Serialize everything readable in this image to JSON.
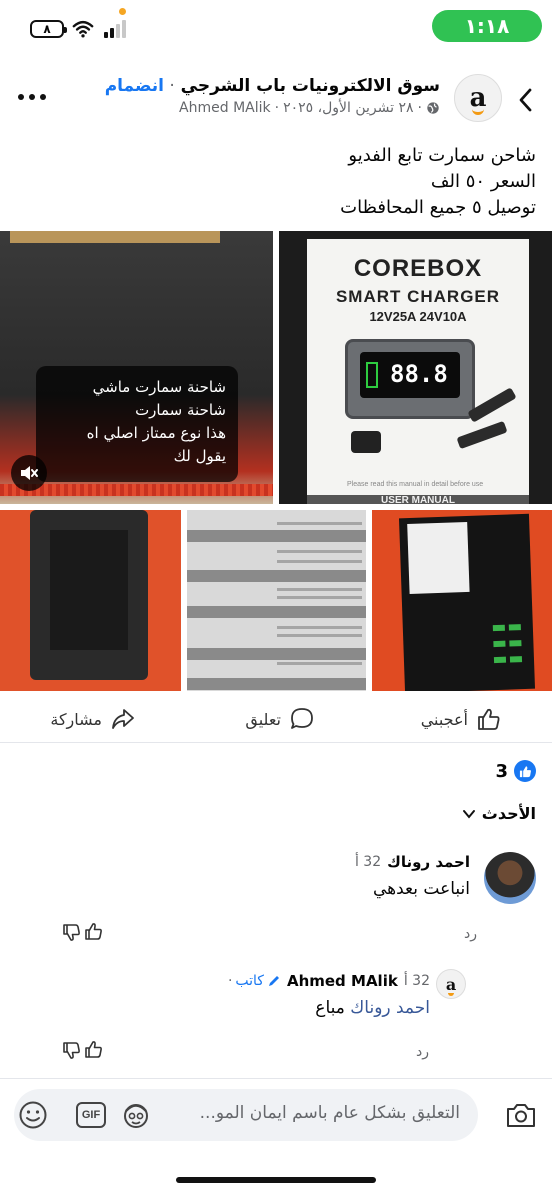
{
  "status_bar": {
    "time": "١:١٨",
    "battery": "٨"
  },
  "post": {
    "page_name": "سوق الالكترونيات باب الشرجي",
    "join_label": "انضمام",
    "author": "Ahmed MAlik",
    "date": "٢٨ تشرين الأول، ٢٠٢٥",
    "text_lines": [
      "شاحن سمارت تابع الفديو",
      "السعر ٥٠ الف",
      "توصيل ٥ جميع المحافظات"
    ]
  },
  "media": {
    "overlay_lines": [
      "شاحنة سمارت ماشي",
      "شاحنة سمارت",
      "هذا نوع ممتاز اصلي اه",
      "يقول لك"
    ],
    "product_brand": "COREBOX",
    "product_title": "SMART CHARGER",
    "product_spec": "12V25A  24V10A",
    "display_digits": "88.8",
    "manual_label": "USER MANUAL",
    "manual_note": "Please read this manual in detail before use"
  },
  "actions": {
    "like": "أعجبني",
    "comment": "تعليق",
    "share": "مشاركة"
  },
  "reactions": {
    "count": "3"
  },
  "sort": {
    "label": "الأحدث"
  },
  "comments": [
    {
      "name": "احمد روناك",
      "time": "32 أ",
      "text": "انباعت بعدهي",
      "reply": "رد"
    },
    {
      "name": "Ahmed MAlik",
      "badge": "كاتب",
      "time": "32 أ",
      "mention": "احمد روناك",
      "text": "مباع",
      "reply": "رد"
    }
  ],
  "composer": {
    "placeholder": "التعليق بشكل عام باسم ايمان المو..."
  },
  "colors": {
    "accent": "#1877f2",
    "status_green": "#30c253"
  }
}
